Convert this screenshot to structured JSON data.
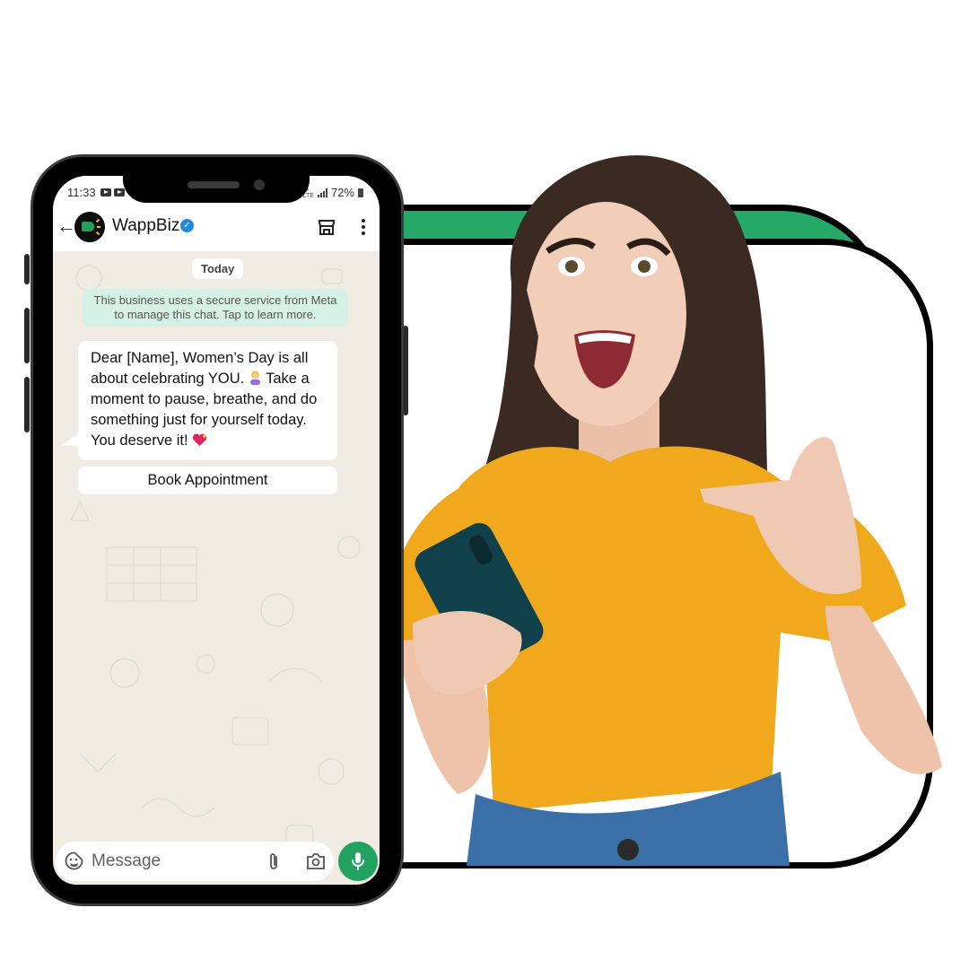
{
  "colors": {
    "brand_green": "#25A868",
    "whatsapp_green": "#21A35F",
    "system_message_bg": "#D6F2E6",
    "chat_bg": "#F1ECE3",
    "verified_blue": "#1E88E5",
    "shirt_yellow": "#F0A81C",
    "held_phone_teal": "#10404A"
  },
  "status_bar": {
    "time": "11:33",
    "network": "LTE",
    "battery": "72%",
    "notification_icons": [
      "youtube-icon",
      "youtube-icon"
    ]
  },
  "header": {
    "back_icon": "arrow-left-icon",
    "contact_name": "WappBiz",
    "verified_icon": "verified-badge-icon",
    "avatar_icon": "megaphone-chat-icon",
    "actions": [
      "storefront-icon",
      "more-vertical-icon"
    ]
  },
  "chat": {
    "date_chip": "Today",
    "system_message": "This business uses a secure service from Meta to manage this chat. Tap to learn more.",
    "message": {
      "part1": "Dear [Name], Women’s Day is all about celebrating YOU. ",
      "emoji1": "woman-gesturing-emoji",
      "part2": " Take a moment to pause, breathe, and do something just for yourself today. You deserve it! ",
      "emoji2": "sparkling-heart-emoji"
    },
    "cta_button": "Book Appointment"
  },
  "composer": {
    "placeholder": "Message",
    "value": "",
    "icons": [
      "sticker-icon",
      "paperclip-icon",
      "camera-icon"
    ],
    "send_icon": "microphone-icon"
  },
  "promo_image": {
    "subject": "Excited woman in yellow t-shirt holding a phone and pointing at herself"
  }
}
